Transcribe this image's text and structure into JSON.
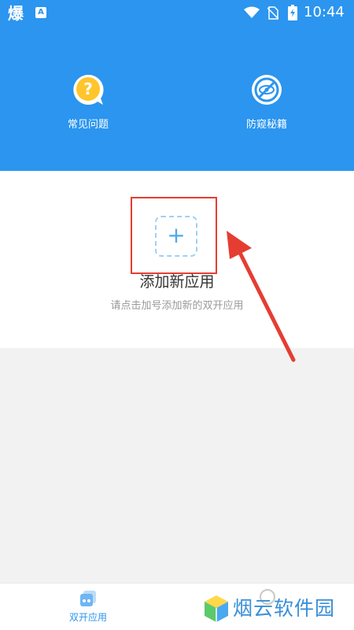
{
  "status_bar": {
    "app_glyph": "爆",
    "notification_glyph": "A",
    "time": "10:44"
  },
  "features": [
    {
      "label": "常见问题",
      "icon": "question-bubble-icon"
    },
    {
      "label": "防窥秘籍",
      "icon": "no-eye-icon"
    }
  ],
  "main": {
    "add_symbol": "+",
    "title": "添加新应用",
    "subtitle": "请点击加号添加新的双开应用"
  },
  "bottom_nav": {
    "tabs": [
      {
        "label": "双开应用",
        "icon": "dual-apps-icon"
      }
    ]
  },
  "watermark": {
    "text": "烟云软件园"
  },
  "colors": {
    "header_blue": "#2b95ef",
    "highlight_red": "#e53d32",
    "add_blue": "#4aa8ef",
    "faq_yellow": "#ffc52b"
  }
}
